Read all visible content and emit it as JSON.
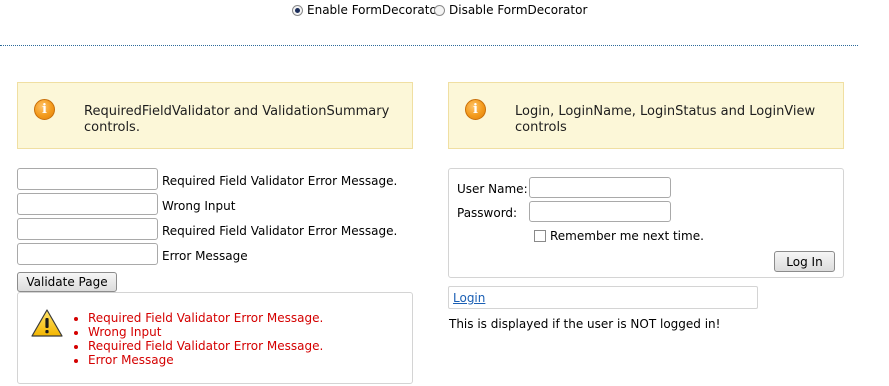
{
  "decorator": {
    "enable_label": "Enable FormDecorator",
    "disable_label": "Disable FormDecorator",
    "selected": "enable"
  },
  "left_panel": {
    "info_text": "RequiredFieldValidator and ValidationSummary controls.",
    "validators": [
      {
        "message": "Required Field Validator Error Message."
      },
      {
        "message": "Wrong Input"
      },
      {
        "message": "Required Field Validator Error Message."
      },
      {
        "message": "Error Message"
      }
    ],
    "validate_button": "Validate Page",
    "summary": [
      "Required Field Validator Error Message.",
      "Wrong Input",
      "Required Field Validator Error Message.",
      "Error Message"
    ]
  },
  "right_panel": {
    "info_text": "Login, LoginName, LoginStatus and LoginView controls",
    "username_label": "User Name:",
    "password_label": "Password:",
    "remember_label": "Remember me next time.",
    "login_button": "Log In",
    "login_status_link": "Login",
    "login_view_text": "This is displayed if the user is NOT logged in!"
  },
  "colors": {
    "info_background": "#fcf7d8",
    "error_text": "#d40000",
    "link": "#1a5fb4"
  },
  "icons": [
    "info-icon",
    "warning-icon"
  ]
}
